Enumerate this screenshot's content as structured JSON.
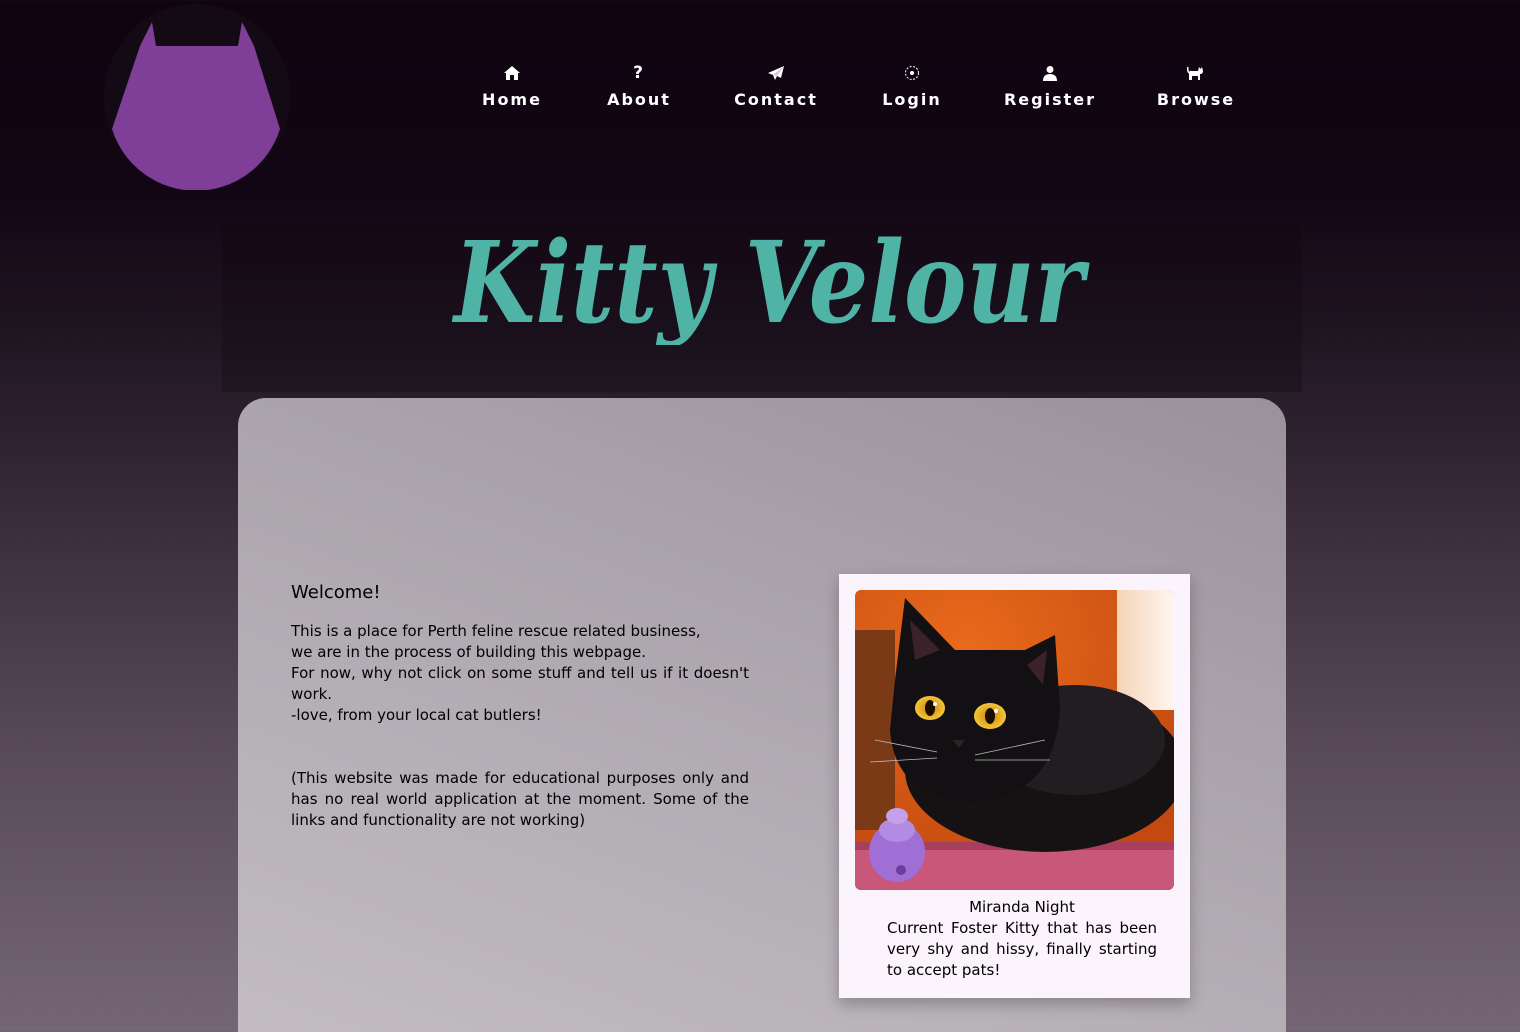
{
  "logo": {
    "icon": "cat-head-logo",
    "color": "#7f3f98"
  },
  "nav": {
    "items": [
      {
        "label": "Home",
        "icon": "home-icon"
      },
      {
        "label": "About",
        "icon": "question-icon"
      },
      {
        "label": "Contact",
        "icon": "paper-plane-icon"
      },
      {
        "label": "Login",
        "icon": "login-icon"
      },
      {
        "label": "Register",
        "icon": "user-icon"
      },
      {
        "label": "Browse",
        "icon": "cat-icon"
      }
    ]
  },
  "brand": {
    "title": "Kitty Velour",
    "color": "#4fb3a6"
  },
  "welcome": {
    "heading": "Welcome!",
    "line1": "This is a place for Perth feline rescue related business,",
    "line2": "we are in the process of building this webpage.",
    "line3": "For now, why not click on some stuff and tell us if it doesn't work.",
    "line4": "-love, from your local cat butlers!",
    "note": "(This website was made for educational purposes only and has no real world application at the moment. Some of the links and functionality are not working)"
  },
  "featured": {
    "name": "Miranda Night",
    "description": "Current Foster Kitty that has been very shy and hissy, finally starting to accept pats!"
  }
}
